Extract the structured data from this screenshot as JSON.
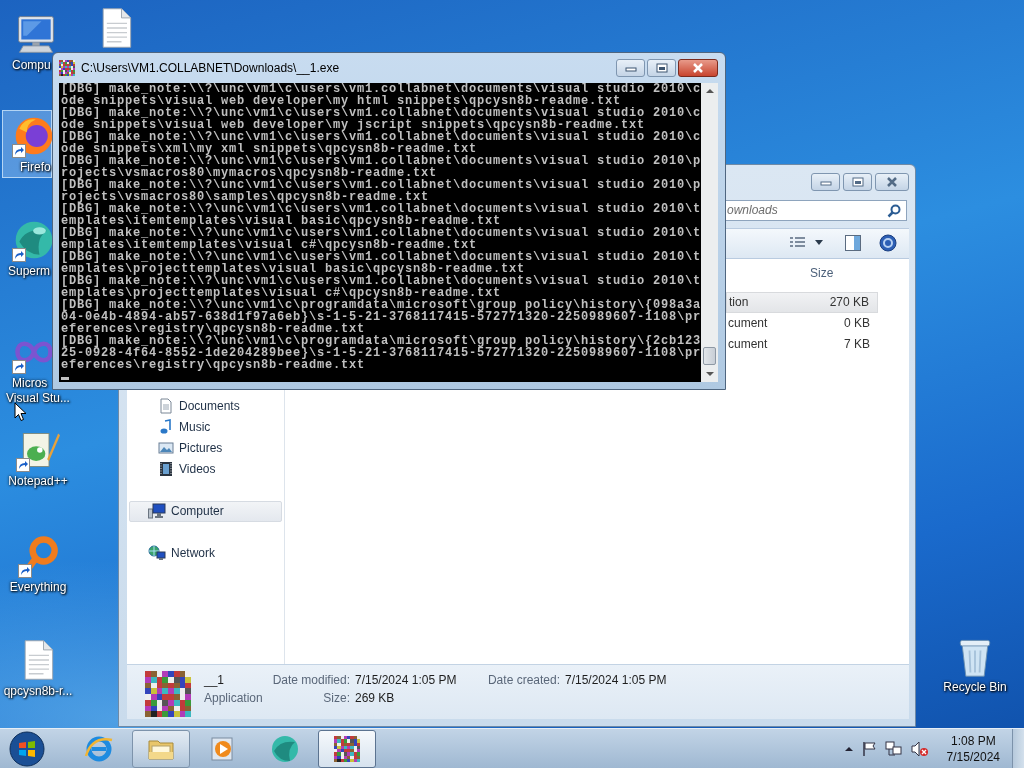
{
  "desktop": {
    "icons": [
      {
        "kind": "computer",
        "label_lines": [
          "Compu"
        ],
        "shortcut": false,
        "selected": false
      },
      {
        "kind": "document",
        "shortcut": false,
        "selected": false
      },
      {
        "kind": "firefox",
        "label_lines": [
          "Firefo"
        ],
        "shortcut": true,
        "selected": true
      },
      {
        "kind": "supermium",
        "label_lines": [
          "Superm"
        ],
        "shortcut": true,
        "selected": false
      },
      {
        "kind": "vstudio",
        "label_lines": [
          "Micros",
          "Visual Stu..."
        ],
        "shortcut": true,
        "selected": false
      },
      {
        "kind": "notepad",
        "label_lines": [
          "Notepad++"
        ],
        "shortcut": true,
        "selected": false
      },
      {
        "kind": "everything",
        "label_lines": [
          "Everything"
        ],
        "shortcut": true,
        "selected": false
      },
      {
        "kind": "document",
        "label_lines": [
          "qpcysn8b-r..."
        ],
        "shortcut": false,
        "selected": false
      },
      {
        "kind": "recycle",
        "label_lines": [
          "Recycle Bin"
        ],
        "shortcut": false,
        "selected": false
      }
    ]
  },
  "console": {
    "title": "C:\\Users\\VM1.COLLABNET\\Downloads\\__1.exe",
    "lines": [
      "[DBG] make_note:\\\\?\\unc\\vm1\\c\\users\\vm1.collabnet\\documents\\visual studio 2010\\c",
      "ode snippets\\visual web developer\\my html snippets\\qpcysn8b-readme.txt",
      "[DBG] make_note:\\\\?\\unc\\vm1\\c\\users\\vm1.collabnet\\documents\\visual studio 2010\\c",
      "ode snippets\\visual web developer\\my jscript snippets\\qpcysn8b-readme.txt",
      "[DBG] make_note:\\\\?\\unc\\vm1\\c\\users\\vm1.collabnet\\documents\\visual studio 2010\\c",
      "ode snippets\\xml\\my xml snippets\\qpcysn8b-readme.txt",
      "[DBG] make_note:\\\\?\\unc\\vm1\\c\\users\\vm1.collabnet\\documents\\visual studio 2010\\p",
      "rojects\\vsmacros80\\mymacros\\qpcysn8b-readme.txt",
      "[DBG] make_note:\\\\?\\unc\\vm1\\c\\users\\vm1.collabnet\\documents\\visual studio 2010\\p",
      "rojects\\vsmacros80\\samples\\qpcysn8b-readme.txt",
      "[DBG] make_note:\\\\?\\unc\\vm1\\c\\users\\vm1.collabnet\\documents\\visual studio 2010\\t",
      "emplates\\itemtemplates\\visual basic\\qpcysn8b-readme.txt",
      "[DBG] make_note:\\\\?\\unc\\vm1\\c\\users\\vm1.collabnet\\documents\\visual studio 2010\\t",
      "emplates\\itemtemplates\\visual c#\\qpcysn8b-readme.txt",
      "[DBG] make_note:\\\\?\\unc\\vm1\\c\\users\\vm1.collabnet\\documents\\visual studio 2010\\t",
      "emplates\\projecttemplates\\visual basic\\qpcysn8b-readme.txt",
      "[DBG] make_note:\\\\?\\unc\\vm1\\c\\users\\vm1.collabnet\\documents\\visual studio 2010\\t",
      "emplates\\projecttemplates\\visual c#\\qpcysn8b-readme.txt",
      "[DBG] make_note:\\\\?\\unc\\vm1\\c\\programdata\\microsoft\\group policy\\history\\{098a3a",
      "04-0e4b-4894-ab57-638d1f97a6eb}\\s-1-5-21-3768117415-572771320-2250989607-1108\\pr",
      "eferences\\registry\\qpcysn8b-readme.txt",
      "[DBG] make_note:\\\\?\\unc\\vm1\\c\\programdata\\microsoft\\group policy\\history\\{2cb123",
      "25-0928-4f64-8552-1de204289bee}\\s-1-5-21-3768117415-572771320-2250989607-1108\\pr",
      "eferences\\registry\\qpcysn8b-readme.txt"
    ]
  },
  "explorer": {
    "search": {
      "placeholder": "ownloads"
    },
    "columns": [
      {
        "label": "Size"
      }
    ],
    "files": [
      {
        "name": "tion",
        "size": "270 KB",
        "selected": true
      },
      {
        "name": "cument",
        "size": "0 KB",
        "selected": false
      },
      {
        "name": "cument",
        "size": "7 KB",
        "selected": false
      }
    ],
    "libraries": [
      {
        "kind": "documents",
        "label": "Documents",
        "selected": false
      },
      {
        "kind": "music",
        "label": "Music",
        "selected": false
      },
      {
        "kind": "pictures",
        "label": "Pictures",
        "selected": false
      },
      {
        "kind": "videos",
        "label": "Videos",
        "selected": false
      }
    ],
    "nav": [
      {
        "kind": "computer",
        "label": "Computer",
        "selected": true
      },
      {
        "kind": "network",
        "label": "Network",
        "selected": false
      }
    ],
    "details": {
      "name": "__1",
      "type": "Application",
      "fields": [
        {
          "label": "Date modified:",
          "value": "7/15/2024 1:05 PM"
        },
        {
          "label": "Date created:",
          "value": "7/15/2024 1:05 PM"
        },
        {
          "label": "Size:",
          "value": "269 KB"
        }
      ]
    }
  },
  "taskbar": {
    "apps": [
      {
        "kind": "ie",
        "running": false,
        "selected": false
      },
      {
        "kind": "explorer",
        "running": true,
        "selected": false
      },
      {
        "kind": "media",
        "running": false,
        "selected": false
      },
      {
        "kind": "supermium",
        "running": false,
        "selected": false
      },
      {
        "kind": "noise",
        "running": true,
        "selected": true
      }
    ],
    "clock": {
      "time": "1:08 PM",
      "date": "7/15/2024"
    }
  }
}
